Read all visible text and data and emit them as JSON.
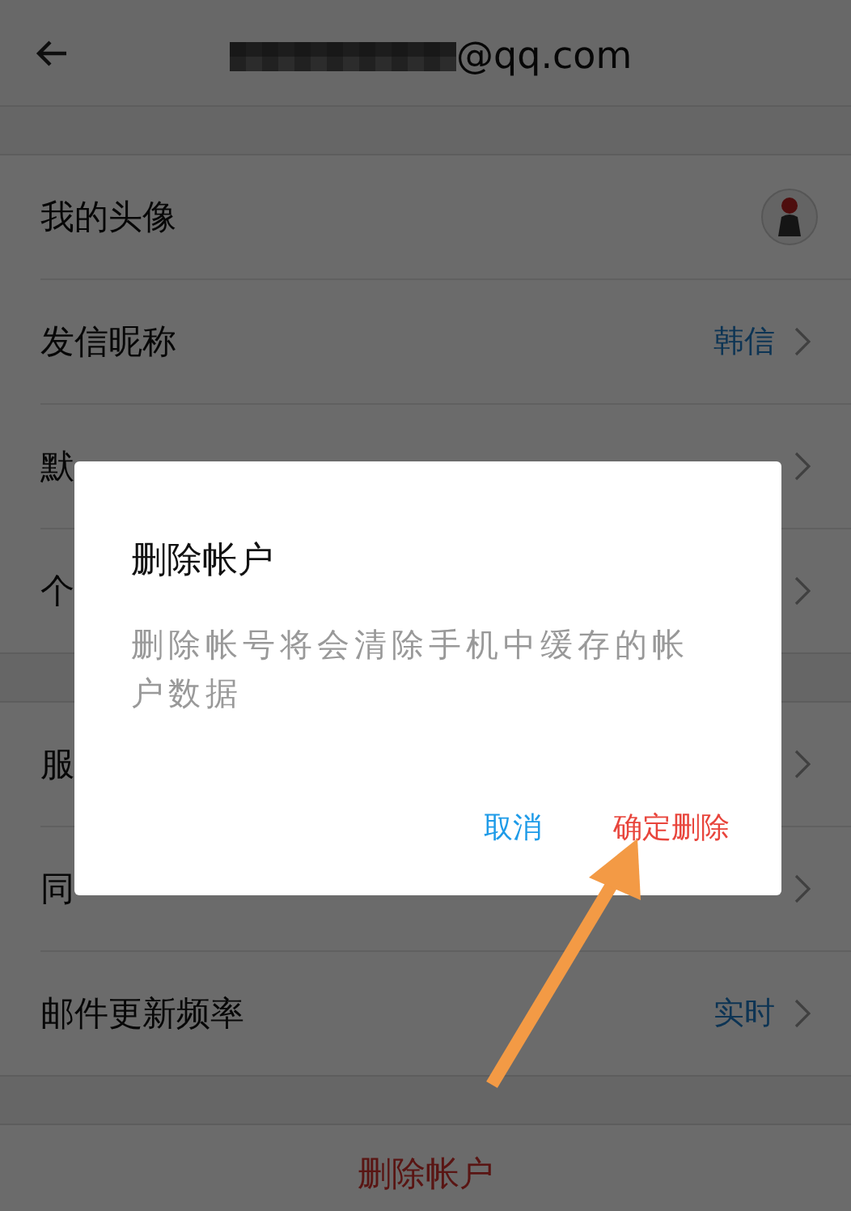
{
  "header": {
    "title": "@qq.com"
  },
  "sections": [
    [
      {
        "kind": "avatar",
        "label": "我的头像"
      },
      {
        "kind": "value",
        "label": "发信昵称",
        "value": "韩信"
      },
      {
        "kind": "plain",
        "label": "默"
      },
      {
        "kind": "plain",
        "label": "个"
      }
    ],
    [
      {
        "kind": "plain",
        "label": "服"
      },
      {
        "kind": "plain",
        "label": "同"
      },
      {
        "kind": "value",
        "label": "邮件更新频率",
        "value": "实时"
      }
    ]
  ],
  "delete_button": "删除帐户",
  "dialog": {
    "title": "删除帐户",
    "message": "删除帐号将会清除手机中缓存的帐户数据",
    "buttons": [
      {
        "label": "取消",
        "kind": "cancel"
      },
      {
        "label": "确定删除",
        "kind": "confirm"
      }
    ]
  }
}
